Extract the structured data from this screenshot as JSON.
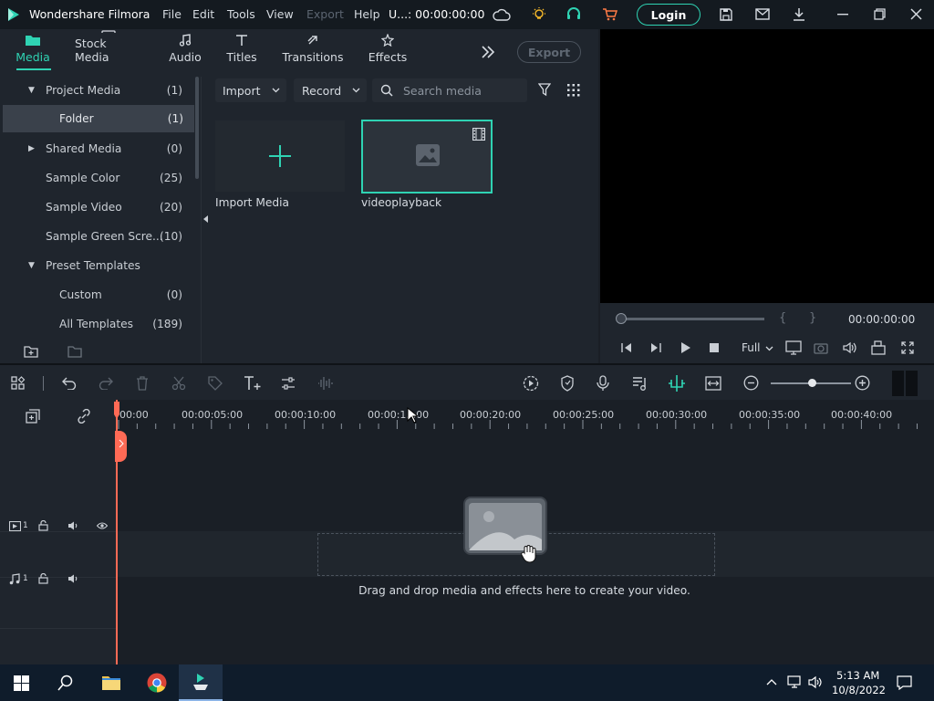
{
  "app": {
    "title": "Wondershare Filmora",
    "menu": [
      "File",
      "Edit",
      "Tools",
      "View",
      "Export",
      "Help"
    ],
    "project_name": "U...",
    "timecode": ": 00:00:00:00",
    "login_label": "Login"
  },
  "tabs": [
    {
      "label": "Media",
      "icon": "folder-icon",
      "active": true
    },
    {
      "label": "Stock Media",
      "icon": "stock-media-icon",
      "active": false
    },
    {
      "label": "Audio",
      "icon": "music-note-icon",
      "active": false
    },
    {
      "label": "Titles",
      "icon": "text-t-icon",
      "active": false
    },
    {
      "label": "Transitions",
      "icon": "transitions-icon",
      "active": false
    },
    {
      "label": "Effects",
      "icon": "effects-icon",
      "active": false
    }
  ],
  "export_label": "Export",
  "sidebar": {
    "items": [
      {
        "label": "Project Media",
        "count": "(1)",
        "expanded": true
      },
      {
        "label": "Folder",
        "count": "(1)",
        "selected": true
      },
      {
        "label": "Shared Media",
        "count": "(0)",
        "expanded": false
      },
      {
        "label": "Sample Color",
        "count": "(25)"
      },
      {
        "label": "Sample Video",
        "count": "(20)"
      },
      {
        "label": "Sample Green Scre...",
        "count": "(10)"
      },
      {
        "label": "Preset Templates",
        "count": "",
        "expanded": true
      },
      {
        "label": "Custom",
        "count": "(0)"
      },
      {
        "label": "All Templates",
        "count": "(189)"
      }
    ]
  },
  "media_toolbar": {
    "import_label": "Import",
    "record_label": "Record",
    "search_placeholder": "Search media"
  },
  "media_items": [
    {
      "label": "Import Media"
    },
    {
      "label": "videoplayback"
    }
  ],
  "preview": {
    "timecode": "00:00:00:00",
    "quality": "Full",
    "mark_in": "{",
    "mark_out": "}"
  },
  "ruler_labels": [
    "00:00",
    "00:00:05:00",
    "00:00:10:00",
    "00:00:15:00",
    "00:00:20:00",
    "00:00:25:00",
    "00:00:30:00",
    "00:00:35:00",
    "00:00:40:00"
  ],
  "tracks": {
    "video_index": "1",
    "audio_index": "1"
  },
  "drop_text": "Drag and drop media and effects here to create your video.",
  "taskbar": {
    "time": "5:13 AM",
    "date": "10/8/2022"
  },
  "colors": {
    "accent": "#2fd3b3",
    "playhead": "#ff6a55"
  }
}
